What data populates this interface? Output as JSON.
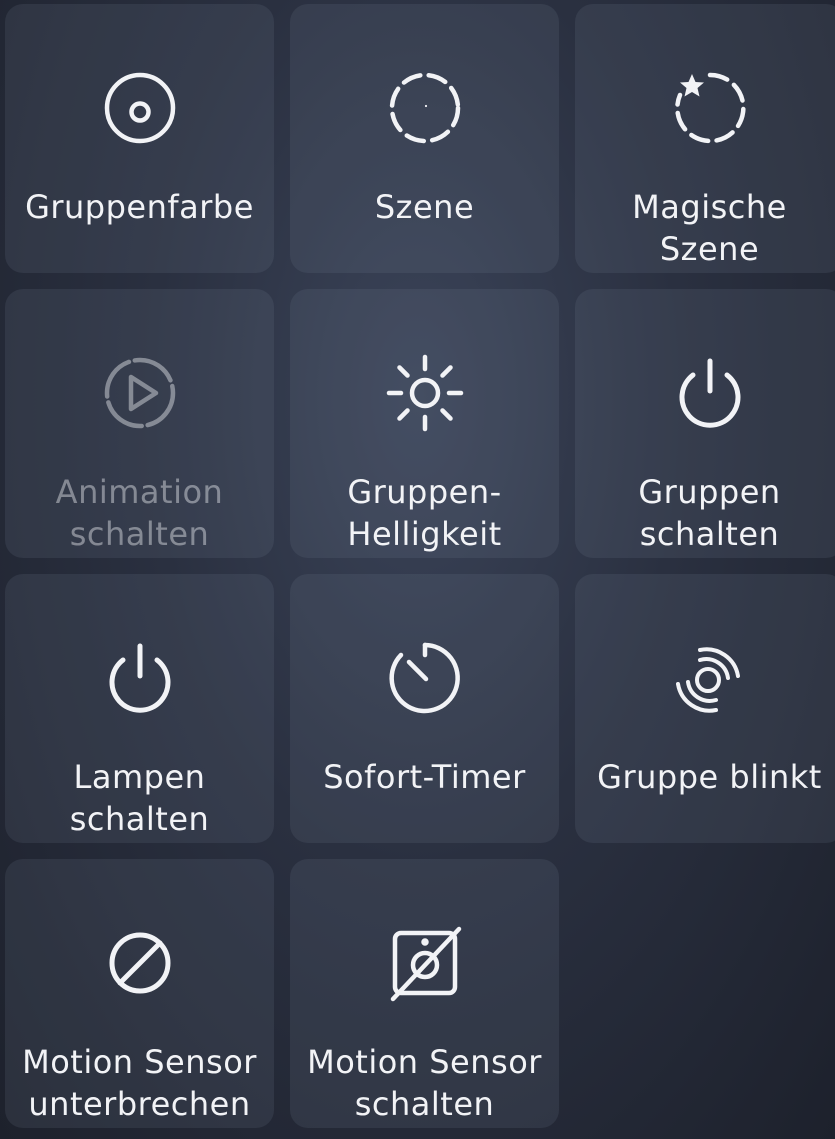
{
  "tiles": [
    {
      "label": "Gruppenfarbe",
      "icon": "color-target-icon",
      "enabled": true
    },
    {
      "label": "Szene",
      "icon": "scene-dashed-circle-icon",
      "enabled": true
    },
    {
      "label": "Magische\nSzene",
      "icon": "magic-scene-star-icon",
      "enabled": true
    },
    {
      "label": "Animation\nschalten",
      "icon": "play-circle-icon",
      "enabled": false
    },
    {
      "label": "Gruppen-\nHelligkeit",
      "icon": "sun-brightness-icon",
      "enabled": true
    },
    {
      "label": "Gruppen\nschalten",
      "icon": "power-icon",
      "enabled": true
    },
    {
      "label": "Lampen\nschalten",
      "icon": "power-icon",
      "enabled": true
    },
    {
      "label": "Sofort-Timer",
      "icon": "timer-icon",
      "enabled": true
    },
    {
      "label": "Gruppe blinkt",
      "icon": "blink-waves-icon",
      "enabled": true
    },
    {
      "label": "Motion Sensor\nunterbrechen",
      "icon": "prohibited-icon",
      "enabled": true
    },
    {
      "label": "Motion Sensor\nschalten",
      "icon": "motion-sensor-off-icon",
      "enabled": true
    }
  ]
}
